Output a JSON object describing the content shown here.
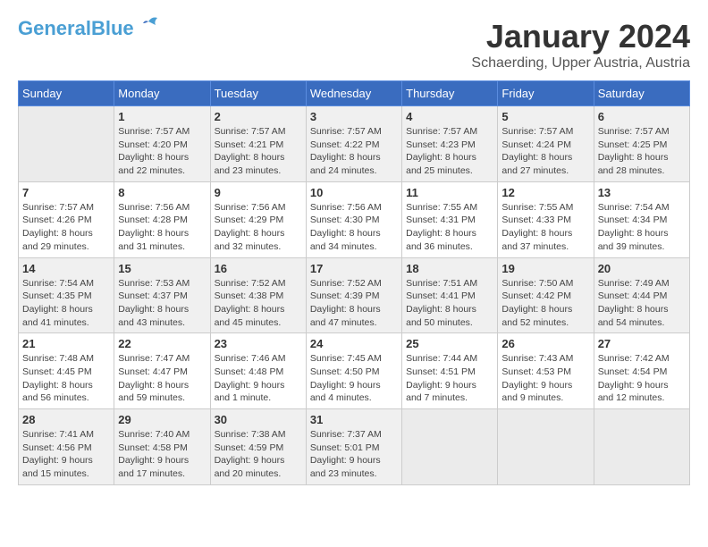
{
  "header": {
    "logo_line1": "General",
    "logo_line2": "Blue",
    "month_year": "January 2024",
    "location": "Schaerding, Upper Austria, Austria"
  },
  "days_of_week": [
    "Sunday",
    "Monday",
    "Tuesday",
    "Wednesday",
    "Thursday",
    "Friday",
    "Saturday"
  ],
  "weeks": [
    [
      {
        "day": "",
        "info": ""
      },
      {
        "day": "1",
        "info": "Sunrise: 7:57 AM\nSunset: 4:20 PM\nDaylight: 8 hours\nand 22 minutes."
      },
      {
        "day": "2",
        "info": "Sunrise: 7:57 AM\nSunset: 4:21 PM\nDaylight: 8 hours\nand 23 minutes."
      },
      {
        "day": "3",
        "info": "Sunrise: 7:57 AM\nSunset: 4:22 PM\nDaylight: 8 hours\nand 24 minutes."
      },
      {
        "day": "4",
        "info": "Sunrise: 7:57 AM\nSunset: 4:23 PM\nDaylight: 8 hours\nand 25 minutes."
      },
      {
        "day": "5",
        "info": "Sunrise: 7:57 AM\nSunset: 4:24 PM\nDaylight: 8 hours\nand 27 minutes."
      },
      {
        "day": "6",
        "info": "Sunrise: 7:57 AM\nSunset: 4:25 PM\nDaylight: 8 hours\nand 28 minutes."
      }
    ],
    [
      {
        "day": "7",
        "info": "Sunrise: 7:57 AM\nSunset: 4:26 PM\nDaylight: 8 hours\nand 29 minutes."
      },
      {
        "day": "8",
        "info": "Sunrise: 7:56 AM\nSunset: 4:28 PM\nDaylight: 8 hours\nand 31 minutes."
      },
      {
        "day": "9",
        "info": "Sunrise: 7:56 AM\nSunset: 4:29 PM\nDaylight: 8 hours\nand 32 minutes."
      },
      {
        "day": "10",
        "info": "Sunrise: 7:56 AM\nSunset: 4:30 PM\nDaylight: 8 hours\nand 34 minutes."
      },
      {
        "day": "11",
        "info": "Sunrise: 7:55 AM\nSunset: 4:31 PM\nDaylight: 8 hours\nand 36 minutes."
      },
      {
        "day": "12",
        "info": "Sunrise: 7:55 AM\nSunset: 4:33 PM\nDaylight: 8 hours\nand 37 minutes."
      },
      {
        "day": "13",
        "info": "Sunrise: 7:54 AM\nSunset: 4:34 PM\nDaylight: 8 hours\nand 39 minutes."
      }
    ],
    [
      {
        "day": "14",
        "info": "Sunrise: 7:54 AM\nSunset: 4:35 PM\nDaylight: 8 hours\nand 41 minutes."
      },
      {
        "day": "15",
        "info": "Sunrise: 7:53 AM\nSunset: 4:37 PM\nDaylight: 8 hours\nand 43 minutes."
      },
      {
        "day": "16",
        "info": "Sunrise: 7:52 AM\nSunset: 4:38 PM\nDaylight: 8 hours\nand 45 minutes."
      },
      {
        "day": "17",
        "info": "Sunrise: 7:52 AM\nSunset: 4:39 PM\nDaylight: 8 hours\nand 47 minutes."
      },
      {
        "day": "18",
        "info": "Sunrise: 7:51 AM\nSunset: 4:41 PM\nDaylight: 8 hours\nand 50 minutes."
      },
      {
        "day": "19",
        "info": "Sunrise: 7:50 AM\nSunset: 4:42 PM\nDaylight: 8 hours\nand 52 minutes."
      },
      {
        "day": "20",
        "info": "Sunrise: 7:49 AM\nSunset: 4:44 PM\nDaylight: 8 hours\nand 54 minutes."
      }
    ],
    [
      {
        "day": "21",
        "info": "Sunrise: 7:48 AM\nSunset: 4:45 PM\nDaylight: 8 hours\nand 56 minutes."
      },
      {
        "day": "22",
        "info": "Sunrise: 7:47 AM\nSunset: 4:47 PM\nDaylight: 8 hours\nand 59 minutes."
      },
      {
        "day": "23",
        "info": "Sunrise: 7:46 AM\nSunset: 4:48 PM\nDaylight: 9 hours\nand 1 minute."
      },
      {
        "day": "24",
        "info": "Sunrise: 7:45 AM\nSunset: 4:50 PM\nDaylight: 9 hours\nand 4 minutes."
      },
      {
        "day": "25",
        "info": "Sunrise: 7:44 AM\nSunset: 4:51 PM\nDaylight: 9 hours\nand 7 minutes."
      },
      {
        "day": "26",
        "info": "Sunrise: 7:43 AM\nSunset: 4:53 PM\nDaylight: 9 hours\nand 9 minutes."
      },
      {
        "day": "27",
        "info": "Sunrise: 7:42 AM\nSunset: 4:54 PM\nDaylight: 9 hours\nand 12 minutes."
      }
    ],
    [
      {
        "day": "28",
        "info": "Sunrise: 7:41 AM\nSunset: 4:56 PM\nDaylight: 9 hours\nand 15 minutes."
      },
      {
        "day": "29",
        "info": "Sunrise: 7:40 AM\nSunset: 4:58 PM\nDaylight: 9 hours\nand 17 minutes."
      },
      {
        "day": "30",
        "info": "Sunrise: 7:38 AM\nSunset: 4:59 PM\nDaylight: 9 hours\nand 20 minutes."
      },
      {
        "day": "31",
        "info": "Sunrise: 7:37 AM\nSunset: 5:01 PM\nDaylight: 9 hours\nand 23 minutes."
      },
      {
        "day": "",
        "info": ""
      },
      {
        "day": "",
        "info": ""
      },
      {
        "day": "",
        "info": ""
      }
    ]
  ]
}
